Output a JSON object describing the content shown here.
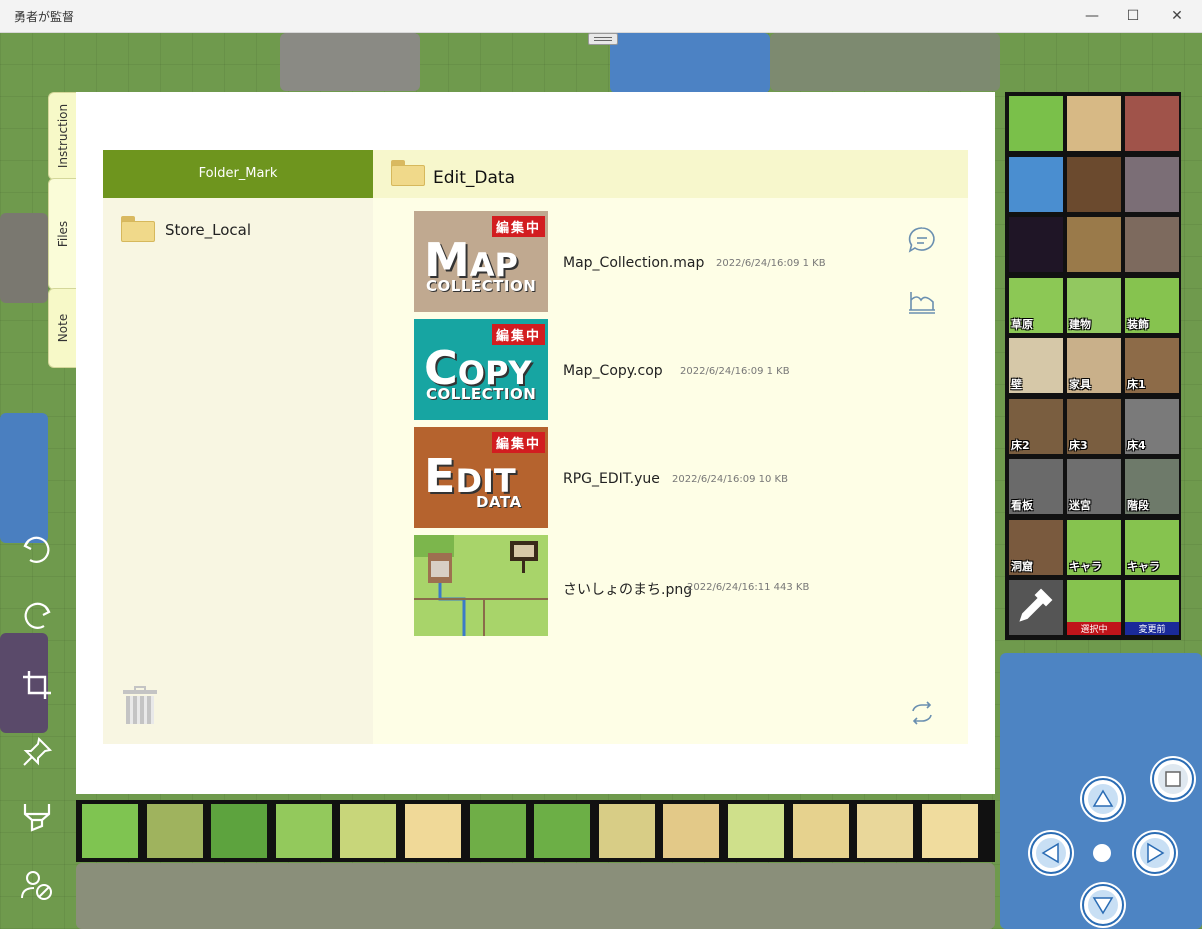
{
  "window": {
    "title": "勇者が監督",
    "controls": [
      "minimize",
      "maximize",
      "close"
    ]
  },
  "side_tabs": [
    {
      "label": "Instruction"
    },
    {
      "label": "Files"
    },
    {
      "label": "Note"
    }
  ],
  "left_panel": {
    "header": "Folder_Mark",
    "folders": [
      {
        "label": "Store_Local",
        "icon": "folder-icon"
      }
    ],
    "trash_icon": "trash-icon"
  },
  "right_panel": {
    "header_title": "Edit_Data",
    "files": [
      {
        "name": "Map_Collection.map",
        "meta": "2022/6/24/16:09  1 KB",
        "thumb": {
          "badge": "編集中",
          "big_initial": "M",
          "big_rest": "AP",
          "sub": "COLLECTION",
          "bg": "#c0a990"
        }
      },
      {
        "name": "Map_Copy.cop",
        "meta": "2022/6/24/16:09  1 KB",
        "thumb": {
          "badge": "編集中",
          "big_initial": "C",
          "big_rest": "OPY",
          "sub": "COLLECTION",
          "bg": "#17a5a2"
        }
      },
      {
        "name": "RPG_EDIT.yue",
        "meta": "2022/6/24/16:09  10 KB",
        "thumb": {
          "badge": "編集中",
          "big_initial": "E",
          "big_rest": "DIT",
          "sub": "DATA",
          "bg": "#b5632e"
        }
      },
      {
        "name": "さいしょのまち.png",
        "meta": "2022/6/24/16:11  443 KB",
        "thumb": {
          "badge": "",
          "big_initial": "",
          "big_rest": "",
          "sub": "",
          "bg": "#a8d46a"
        }
      }
    ],
    "actions": [
      "chat-icon",
      "scene-icon",
      "refresh-icon"
    ]
  },
  "palette": {
    "tiles": [
      {
        "label": "",
        "color": "#7ac04a"
      },
      {
        "label": "",
        "color": "#d7b985"
      },
      {
        "label": "",
        "color": "#a0534a"
      },
      {
        "label": "",
        "color": "#4a8ed0"
      },
      {
        "label": "",
        "color": "#6b4a2e"
      },
      {
        "label": "",
        "color": "#7b6e76"
      },
      {
        "label": "",
        "color": "#1f1526"
      },
      {
        "label": "",
        "color": "#9a7a4a"
      },
      {
        "label": "",
        "color": "#7d6a5e"
      },
      {
        "label": "草原",
        "color": "#8cc855"
      },
      {
        "label": "建物",
        "color": "#92c860"
      },
      {
        "label": "装飾",
        "color": "#86c34f"
      },
      {
        "label": "壁",
        "color": "#d6c8a8"
      },
      {
        "label": "家具",
        "color": "#c9b08a"
      },
      {
        "label": "床1",
        "color": "#8d6b48"
      },
      {
        "label": "床2",
        "color": "#7a5e40"
      },
      {
        "label": "床3",
        "color": "#7a5e40"
      },
      {
        "label": "床4",
        "color": "#7a7a7a"
      },
      {
        "label": "看板",
        "color": "#6a6a6a"
      },
      {
        "label": "迷宮",
        "color": "#6f6f6f"
      },
      {
        "label": "階段",
        "color": "#6e7a6a"
      },
      {
        "label": "洞窟",
        "color": "#7a5a3e"
      },
      {
        "label": "キャラ",
        "color": "#86c34f"
      },
      {
        "label": "キャラ",
        "color": "#86c34f"
      },
      {
        "label": "",
        "color": "#555555"
      },
      {
        "label": "",
        "color": "#86c34f"
      },
      {
        "label": "",
        "color": "#86c34f"
      }
    ],
    "bottom_tags": {
      "selected": "選択中",
      "before": "変更前"
    }
  },
  "strip": {
    "tiles": [
      "#7fc451",
      "#9fb35e",
      "#5da33e",
      "#93c95c",
      "#c8d67a",
      "#f0d998",
      "#6fae47",
      "#6caf46",
      "#d8cd86",
      "#e3c988",
      "#cfe08b",
      "#e6d28e",
      "#e9d79a",
      "#f0dc9e"
    ]
  },
  "tools": [
    "undo-icon",
    "redo-icon",
    "crop-icon",
    "pin-icon",
    "highlighter-icon",
    "user-block-icon"
  ],
  "dpad": [
    "up-arrow-icon",
    "left-arrow-icon",
    "right-arrow-icon",
    "down-arrow-icon",
    "stop-icon",
    "center-dot-icon"
  ]
}
